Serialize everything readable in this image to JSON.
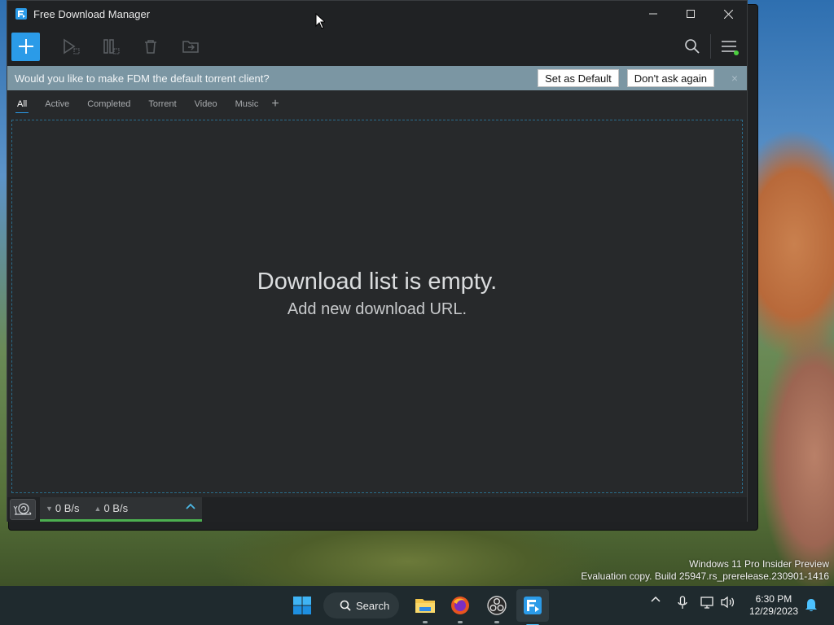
{
  "window": {
    "title": "Free Download Manager",
    "controls": [
      "minimize",
      "maximize",
      "close"
    ]
  },
  "toolbar": {
    "buttons": [
      "add-download",
      "resume",
      "pause",
      "delete",
      "move-to-folder"
    ],
    "right": [
      "search",
      "main-menu"
    ]
  },
  "notification": {
    "message": "Would you like to make FDM the default torrent client?",
    "set_default_label": "Set as Default",
    "dont_ask_label": "Don't ask again",
    "close_glyph": "×"
  },
  "tabs": [
    {
      "label": "All",
      "active": true
    },
    {
      "label": "Active",
      "active": false
    },
    {
      "label": "Completed",
      "active": false
    },
    {
      "label": "Torrent",
      "active": false
    },
    {
      "label": "Video",
      "active": false
    },
    {
      "label": "Music",
      "active": false
    }
  ],
  "tab_add_glyph": "+",
  "empty_state": {
    "title": "Download list is empty.",
    "subtitle": "Add new download URL."
  },
  "status": {
    "download_speed": "0 B/s",
    "upload_speed": "0 B/s"
  },
  "desktop": {
    "watermark_line1": "Windows 11 Pro Insider Preview",
    "watermark_line2": "Evaluation copy. Build 25947.rs_prerelease.230901-1416"
  },
  "taskbar": {
    "search_label": "Search",
    "apps": [
      "start",
      "search",
      "file-explorer",
      "firefox",
      "obs-studio",
      "free-download-manager"
    ],
    "time": "6:30 PM",
    "date": "12/29/2023"
  },
  "colors": {
    "accent": "#2b9be8",
    "notify_bg": "#7b96a3",
    "speed_bar": "#4caf50",
    "window_bg": "#27292b"
  }
}
